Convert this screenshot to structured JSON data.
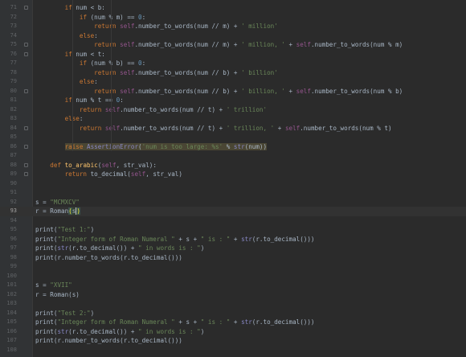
{
  "editor": {
    "current_line": "93",
    "lines": [
      {
        "n": "71",
        "fold": true,
        "s": [
          [
            "        ",
            "pl"
          ],
          [
            "if",
            "kw"
          ],
          [
            " num < b:",
            "pl"
          ]
        ]
      },
      {
        "n": "72",
        "s": [
          [
            "            ",
            "pl"
          ],
          [
            "if",
            "kw"
          ],
          [
            " (num % m) == ",
            "pl"
          ],
          [
            "0",
            "num"
          ],
          [
            ":",
            "pl"
          ]
        ]
      },
      {
        "n": "73",
        "s": [
          [
            "                ",
            "pl"
          ],
          [
            "return",
            "kw"
          ],
          [
            " ",
            "pl"
          ],
          [
            "self",
            "self"
          ],
          [
            ".number_to_words(num // m) + ",
            "pl"
          ],
          [
            "' million'",
            "str"
          ]
        ]
      },
      {
        "n": "74",
        "s": [
          [
            "            ",
            "pl"
          ],
          [
            "else",
            "kw"
          ],
          [
            ":",
            "pl"
          ]
        ]
      },
      {
        "n": "75",
        "fold": true,
        "s": [
          [
            "                ",
            "pl"
          ],
          [
            "return",
            "kw"
          ],
          [
            " ",
            "pl"
          ],
          [
            "self",
            "self"
          ],
          [
            ".number_to_words(num // m) + ",
            "pl"
          ],
          [
            "' million, '",
            "str"
          ],
          [
            " + ",
            "pl"
          ],
          [
            "self",
            "self"
          ],
          [
            ".number_to_words(num % m)",
            "pl"
          ]
        ]
      },
      {
        "n": "76",
        "fold": true,
        "s": [
          [
            "        ",
            "pl"
          ],
          [
            "if",
            "kw"
          ],
          [
            " num < t:",
            "pl"
          ]
        ]
      },
      {
        "n": "77",
        "s": [
          [
            "            ",
            "pl"
          ],
          [
            "if",
            "kw"
          ],
          [
            " (num % b) == ",
            "pl"
          ],
          [
            "0",
            "num"
          ],
          [
            ":",
            "pl"
          ]
        ]
      },
      {
        "n": "78",
        "s": [
          [
            "                ",
            "pl"
          ],
          [
            "return",
            "kw"
          ],
          [
            " ",
            "pl"
          ],
          [
            "self",
            "self"
          ],
          [
            ".number_to_words(num // b) + ",
            "pl"
          ],
          [
            "' billion'",
            "str"
          ]
        ]
      },
      {
        "n": "79",
        "s": [
          [
            "            ",
            "pl"
          ],
          [
            "else",
            "kw"
          ],
          [
            ":",
            "pl"
          ]
        ]
      },
      {
        "n": "80",
        "fold": true,
        "s": [
          [
            "                ",
            "pl"
          ],
          [
            "return",
            "kw"
          ],
          [
            " ",
            "pl"
          ],
          [
            "self",
            "self"
          ],
          [
            ".number_to_words(num // b) + ",
            "pl"
          ],
          [
            "' billion, '",
            "str"
          ],
          [
            " + ",
            "pl"
          ],
          [
            "self",
            "self"
          ],
          [
            ".number_to_words(num % b)",
            "pl"
          ]
        ]
      },
      {
        "n": "81",
        "s": [
          [
            "        ",
            "pl"
          ],
          [
            "if",
            "kw"
          ],
          [
            " num % t == ",
            "pl"
          ],
          [
            "0",
            "num"
          ],
          [
            ":",
            "pl"
          ]
        ]
      },
      {
        "n": "82",
        "s": [
          [
            "            ",
            "pl"
          ],
          [
            "return",
            "kw"
          ],
          [
            " ",
            "pl"
          ],
          [
            "self",
            "self"
          ],
          [
            ".number_to_words(num // t) + ",
            "pl"
          ],
          [
            "' trillion'",
            "str"
          ]
        ]
      },
      {
        "n": "83",
        "s": [
          [
            "        ",
            "pl"
          ],
          [
            "else",
            "kw"
          ],
          [
            ":",
            "pl"
          ]
        ]
      },
      {
        "n": "84",
        "fold": true,
        "s": [
          [
            "            ",
            "pl"
          ],
          [
            "return",
            "kw"
          ],
          [
            " ",
            "pl"
          ],
          [
            "self",
            "self"
          ],
          [
            ".number_to_words(num // t) + ",
            "pl"
          ],
          [
            "' trillion, '",
            "str"
          ],
          [
            " + ",
            "pl"
          ],
          [
            "self",
            "self"
          ],
          [
            ".number_to_words(num % t)",
            "pl"
          ]
        ]
      },
      {
        "n": "85",
        "s": []
      },
      {
        "n": "86",
        "fold": true,
        "s": [
          [
            "        ",
            "pl"
          ],
          [
            "raise",
            "kw hl"
          ],
          [
            " ",
            "pl hl"
          ],
          [
            "AssertionError",
            "bi hl"
          ],
          [
            "(",
            "pl hl"
          ],
          [
            "'num is too large: %s'",
            "str hl"
          ],
          [
            " % ",
            "pl hl"
          ],
          [
            "str",
            "bi hl"
          ],
          [
            "(num))",
            "pl hl"
          ]
        ]
      },
      {
        "n": "87",
        "s": []
      },
      {
        "n": "88",
        "fold": true,
        "s": [
          [
            "    ",
            "pl"
          ],
          [
            "def",
            "kw"
          ],
          [
            " ",
            "pl"
          ],
          [
            "to_arabic",
            "fn"
          ],
          [
            "(",
            "pl"
          ],
          [
            "self",
            "self"
          ],
          [
            ", str_val):",
            "pl"
          ]
        ]
      },
      {
        "n": "89",
        "fold": true,
        "s": [
          [
            "        ",
            "pl"
          ],
          [
            "return",
            "kw"
          ],
          [
            " to_decimal(",
            "pl"
          ],
          [
            "self",
            "self"
          ],
          [
            ", str_val)",
            "pl"
          ]
        ]
      },
      {
        "n": "90",
        "s": []
      },
      {
        "n": "91",
        "s": []
      },
      {
        "n": "92",
        "s": [
          [
            "s = ",
            "pl"
          ],
          [
            "\"MCMXCV\"",
            "str"
          ]
        ]
      },
      {
        "n": "93",
        "s": [
          [
            "r = Roman",
            "pl"
          ],
          [
            "(",
            "brk"
          ],
          [
            "s",
            "pl sel"
          ],
          [
            ")",
            "brk caret"
          ]
        ]
      },
      {
        "n": "94",
        "s": []
      },
      {
        "n": "95",
        "s": [
          [
            "print",
            "pl"
          ],
          [
            "(",
            "pl"
          ],
          [
            "\"Test 1:\"",
            "str"
          ],
          [
            ")",
            "pl"
          ]
        ]
      },
      {
        "n": "96",
        "s": [
          [
            "print(",
            "pl"
          ],
          [
            "\"Integer form of Roman Numeral \"",
            "str"
          ],
          [
            " + s + ",
            "pl"
          ],
          [
            "\" is : \"",
            "str"
          ],
          [
            " + ",
            "pl"
          ],
          [
            "str",
            "bi"
          ],
          [
            "(r.to_decimal()))",
            "pl"
          ]
        ]
      },
      {
        "n": "97",
        "s": [
          [
            "print(",
            "pl"
          ],
          [
            "str",
            "bi"
          ],
          [
            "(r.to_decimal()) + ",
            "pl"
          ],
          [
            "\" in words is : \"",
            "str"
          ],
          [
            ")",
            "pl"
          ]
        ]
      },
      {
        "n": "98",
        "s": [
          [
            "print(r.number_to_words(r.to_decimal()))",
            "pl"
          ]
        ]
      },
      {
        "n": "99",
        "s": []
      },
      {
        "n": "100",
        "s": []
      },
      {
        "n": "101",
        "s": [
          [
            "s = ",
            "pl"
          ],
          [
            "\"XVII\"",
            "str"
          ]
        ]
      },
      {
        "n": "102",
        "s": [
          [
            "r = Roman(s)",
            "pl"
          ]
        ]
      },
      {
        "n": "103",
        "s": []
      },
      {
        "n": "104",
        "s": [
          [
            "print(",
            "pl"
          ],
          [
            "\"Test 2:\"",
            "str"
          ],
          [
            ")",
            "pl"
          ]
        ]
      },
      {
        "n": "105",
        "s": [
          [
            "print(",
            "pl"
          ],
          [
            "\"Integer form of Roman Numeral \"",
            "str"
          ],
          [
            " + s + ",
            "pl"
          ],
          [
            "\" is : \"",
            "str"
          ],
          [
            " + ",
            "pl"
          ],
          [
            "str",
            "bi"
          ],
          [
            "(r.to_decimal()))",
            "pl"
          ]
        ]
      },
      {
        "n": "106",
        "s": [
          [
            "print(",
            "pl"
          ],
          [
            "str",
            "bi"
          ],
          [
            "(r.to_decimal()) + ",
            "pl"
          ],
          [
            "\" in words is : \"",
            "str"
          ],
          [
            ")",
            "pl"
          ]
        ]
      },
      {
        "n": "107",
        "s": [
          [
            "print(r.number_to_words(r.to_decimal()))",
            "pl"
          ]
        ]
      },
      {
        "n": "108",
        "s": []
      }
    ]
  },
  "colors": {
    "background": "#2b2b2b",
    "gutter": "#313335",
    "keyword": "#cc7832",
    "string": "#6a8759",
    "number": "#6897bb",
    "self": "#94558d",
    "function": "#ffc66d",
    "builtin": "#8888c6",
    "text": "#a9b7c6"
  }
}
